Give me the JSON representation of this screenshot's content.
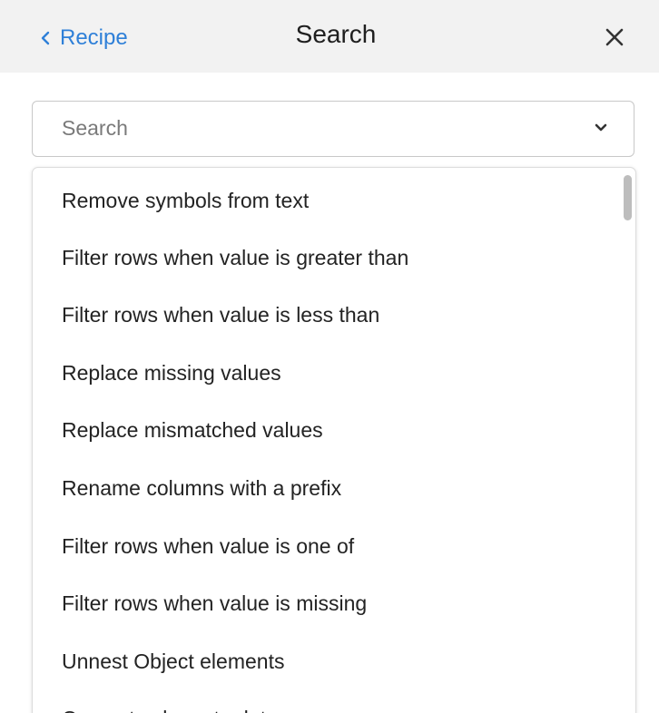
{
  "header": {
    "back_label": "Recipe",
    "title": "Search"
  },
  "search": {
    "placeholder": "Search",
    "value": ""
  },
  "dropdown": {
    "options": [
      "Remove symbols from text",
      "Filter rows when value is greater than",
      "Filter rows when value is less than",
      "Replace missing values",
      "Replace mismatched values",
      "Rename columns with a prefix",
      "Filter rows when value is one of",
      "Filter rows when value is missing",
      "Unnest Object elements",
      "Convert column to date"
    ]
  },
  "colors": {
    "accent": "#2f80d8",
    "header_bg": "#f2f2f2",
    "text": "#232323",
    "border": "#c8c8c8"
  },
  "icons": {
    "back": "chevron-left-icon",
    "close": "close-icon",
    "dropdown": "chevron-down-icon"
  }
}
